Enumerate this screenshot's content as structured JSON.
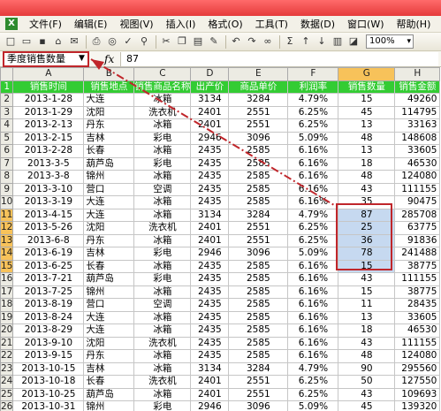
{
  "menu": [
    "文件(F)",
    "编辑(E)",
    "视图(V)",
    "插入(I)",
    "格式(O)",
    "工具(T)",
    "数据(D)",
    "窗口(W)",
    "帮助(H)"
  ],
  "toolbar": {
    "icons": [
      "new-icon",
      "open-icon",
      "save-icon",
      "permission-icon",
      "email-icon",
      "print-icon",
      "print-preview-icon",
      "spelling-icon",
      "research-icon",
      "cut-icon",
      "copy-icon",
      "paste-icon",
      "format-painter-icon",
      "undo-icon",
      "redo-icon",
      "hyperlink-icon",
      "autosum-icon",
      "sort-asc-icon",
      "sort-desc-icon",
      "chart-icon",
      "drawing-icon"
    ],
    "zoom": "100%"
  },
  "formula_bar": {
    "name_box": "季度销售数量",
    "fx": "fx",
    "value": "87"
  },
  "columns": [
    "A",
    "B",
    "C",
    "D",
    "E",
    "F",
    "G",
    "H"
  ],
  "header_row": [
    "销售时间",
    "销售地点",
    "销售商品名称",
    "出产价",
    "商品单价",
    "利润率",
    "销售数量",
    "销售金额"
  ],
  "rows": [
    [
      "2013-1-28",
      "大连",
      "冰箱",
      "3134",
      "3284",
      "4.79%",
      "15",
      "49260"
    ],
    [
      "2013-1-29",
      "沈阳",
      "洗衣机",
      "2401",
      "2551",
      "6.25%",
      "45",
      "114795"
    ],
    [
      "2013-2-13",
      "丹东",
      "冰箱",
      "2401",
      "2551",
      "6.25%",
      "13",
      "33163"
    ],
    [
      "2013-2-15",
      "吉林",
      "彩电",
      "2946",
      "3096",
      "5.09%",
      "48",
      "148608"
    ],
    [
      "2013-2-28",
      "长春",
      "冰箱",
      "2435",
      "2585",
      "6.16%",
      "13",
      "33605"
    ],
    [
      "2013-3-5",
      "葫芦岛",
      "彩电",
      "2435",
      "2585",
      "6.16%",
      "18",
      "46530"
    ],
    [
      "2013-3-8",
      "锦州",
      "冰箱",
      "2435",
      "2585",
      "6.16%",
      "48",
      "124080"
    ],
    [
      "2013-3-10",
      "营口",
      "空调",
      "2435",
      "2585",
      "6.16%",
      "43",
      "111155"
    ],
    [
      "2013-3-19",
      "大连",
      "冰箱",
      "2435",
      "2585",
      "6.16%",
      "35",
      "90475"
    ],
    [
      "2013-4-15",
      "大连",
      "冰箱",
      "3134",
      "3284",
      "4.79%",
      "87",
      "285708"
    ],
    [
      "2013-5-26",
      "沈阳",
      "洗衣机",
      "2401",
      "2551",
      "6.25%",
      "25",
      "63775"
    ],
    [
      "2013-6-8",
      "丹东",
      "冰箱",
      "2401",
      "2551",
      "6.25%",
      "36",
      "91836"
    ],
    [
      "2013-6-19",
      "吉林",
      "彩电",
      "2946",
      "3096",
      "5.09%",
      "78",
      "241488"
    ],
    [
      "2013-6-25",
      "长春",
      "冰箱",
      "2435",
      "2585",
      "6.16%",
      "15",
      "38775"
    ],
    [
      "2013-7-21",
      "葫芦岛",
      "彩电",
      "2435",
      "2585",
      "6.16%",
      "43",
      "111155"
    ],
    [
      "2013-7-25",
      "锦州",
      "冰箱",
      "2435",
      "2585",
      "6.16%",
      "15",
      "38775"
    ],
    [
      "2013-8-19",
      "营口",
      "空调",
      "2435",
      "2585",
      "6.16%",
      "11",
      "28435"
    ],
    [
      "2013-8-24",
      "大连",
      "冰箱",
      "2435",
      "2585",
      "6.16%",
      "13",
      "33605"
    ],
    [
      "2013-8-29",
      "大连",
      "冰箱",
      "2435",
      "2585",
      "6.16%",
      "18",
      "46530"
    ],
    [
      "2013-9-10",
      "沈阳",
      "洗衣机",
      "2435",
      "2585",
      "6.16%",
      "43",
      "111155"
    ],
    [
      "2013-9-15",
      "丹东",
      "冰箱",
      "2435",
      "2585",
      "6.16%",
      "48",
      "124080"
    ],
    [
      "2013-10-15",
      "吉林",
      "冰箱",
      "3134",
      "3284",
      "4.79%",
      "90",
      "295560"
    ],
    [
      "2013-10-18",
      "长春",
      "洗衣机",
      "2401",
      "2551",
      "6.25%",
      "50",
      "127550"
    ],
    [
      "2013-10-25",
      "葫芦岛",
      "冰箱",
      "2401",
      "2551",
      "6.25%",
      "43",
      "109693"
    ],
    [
      "2013-10-31",
      "锦州",
      "彩电",
      "2946",
      "3096",
      "5.09%",
      "45",
      "139320"
    ],
    [
      "2013-11-5",
      "营口",
      "冰箱",
      "2435",
      "2585",
      "6.16%",
      "...",
      "..."
    ]
  ],
  "highlighted_rows": [
    11,
    12,
    13,
    14,
    15
  ],
  "highlight_color": "#c6d9f0",
  "header_color": "#33cc33",
  "accent_color": "#c0262b"
}
